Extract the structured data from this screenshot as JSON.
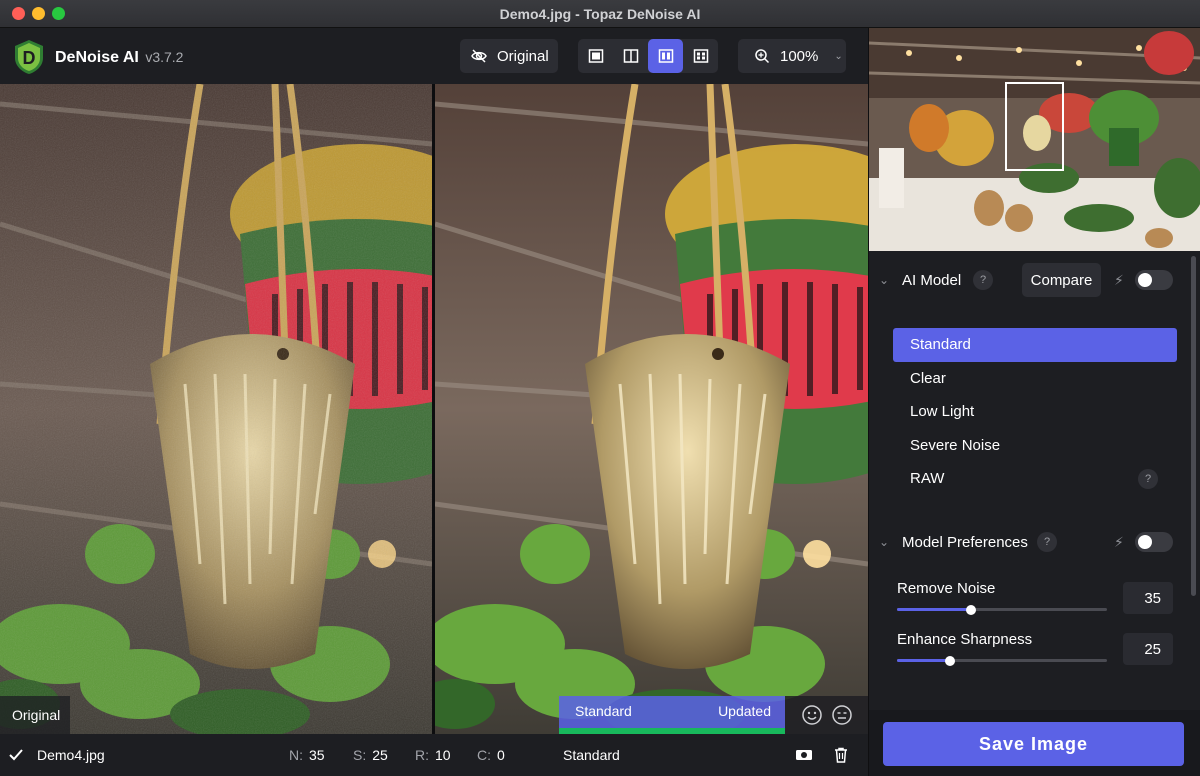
{
  "window": {
    "title": "Demo4.jpg - Topaz DeNoise AI"
  },
  "app": {
    "name": "DeNoise AI",
    "version": "v3.7.2",
    "logo_letter": "D"
  },
  "toolbar": {
    "original_label": "Original",
    "zoom_value": "100%",
    "view_modes": [
      "single",
      "split",
      "side-by-side",
      "grid"
    ],
    "active_view": "side-by-side"
  },
  "viewer": {
    "left_label": "Original",
    "right_model": "Standard",
    "right_status": "Updated"
  },
  "statusbar": {
    "file": "Demo4.jpg",
    "n_key": "N:",
    "n_val": "35",
    "s_key": "S:",
    "s_val": "25",
    "r_key": "R:",
    "r_val": "10",
    "c_key": "C:",
    "c_val": "0",
    "model": "Standard"
  },
  "panel": {
    "ai_model": {
      "title": "AI Model",
      "compare_label": "Compare",
      "auto_enabled": false,
      "models": [
        "Standard",
        "Clear",
        "Low Light",
        "Severe Noise",
        "RAW"
      ],
      "selected": "Standard"
    },
    "prefs": {
      "title": "Model Preferences",
      "auto_enabled": false,
      "remove_noise": {
        "label": "Remove Noise",
        "value": "35",
        "fraction": 0.35
      },
      "enhance_sharpness": {
        "label": "Enhance Sharpness",
        "value": "25",
        "fraction": 0.25
      }
    },
    "save_label": "Save Image"
  },
  "colors": {
    "accent": "#5b62e6",
    "updated_bar": "#18b85c"
  }
}
